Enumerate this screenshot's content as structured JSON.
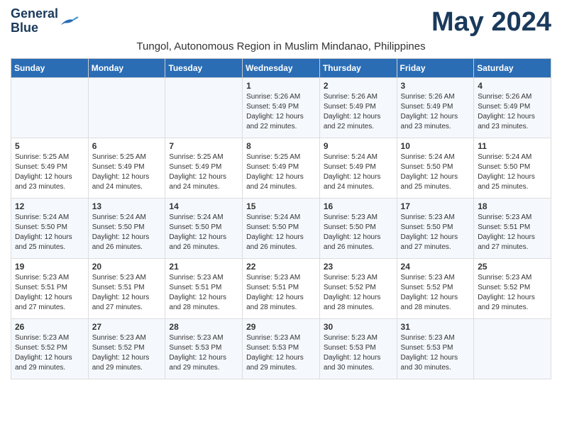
{
  "logo": {
    "line1": "General",
    "line2": "Blue"
  },
  "title": "May 2024",
  "location": "Tungol, Autonomous Region in Muslim Mindanao, Philippines",
  "days_of_week": [
    "Sunday",
    "Monday",
    "Tuesday",
    "Wednesday",
    "Thursday",
    "Friday",
    "Saturday"
  ],
  "weeks": [
    [
      {
        "day": "",
        "detail": ""
      },
      {
        "day": "",
        "detail": ""
      },
      {
        "day": "",
        "detail": ""
      },
      {
        "day": "1",
        "detail": "Sunrise: 5:26 AM\nSunset: 5:49 PM\nDaylight: 12 hours\nand 22 minutes."
      },
      {
        "day": "2",
        "detail": "Sunrise: 5:26 AM\nSunset: 5:49 PM\nDaylight: 12 hours\nand 22 minutes."
      },
      {
        "day": "3",
        "detail": "Sunrise: 5:26 AM\nSunset: 5:49 PM\nDaylight: 12 hours\nand 23 minutes."
      },
      {
        "day": "4",
        "detail": "Sunrise: 5:26 AM\nSunset: 5:49 PM\nDaylight: 12 hours\nand 23 minutes."
      }
    ],
    [
      {
        "day": "5",
        "detail": "Sunrise: 5:25 AM\nSunset: 5:49 PM\nDaylight: 12 hours\nand 23 minutes."
      },
      {
        "day": "6",
        "detail": "Sunrise: 5:25 AM\nSunset: 5:49 PM\nDaylight: 12 hours\nand 24 minutes."
      },
      {
        "day": "7",
        "detail": "Sunrise: 5:25 AM\nSunset: 5:49 PM\nDaylight: 12 hours\nand 24 minutes."
      },
      {
        "day": "8",
        "detail": "Sunrise: 5:25 AM\nSunset: 5:49 PM\nDaylight: 12 hours\nand 24 minutes."
      },
      {
        "day": "9",
        "detail": "Sunrise: 5:24 AM\nSunset: 5:49 PM\nDaylight: 12 hours\nand 24 minutes."
      },
      {
        "day": "10",
        "detail": "Sunrise: 5:24 AM\nSunset: 5:50 PM\nDaylight: 12 hours\nand 25 minutes."
      },
      {
        "day": "11",
        "detail": "Sunrise: 5:24 AM\nSunset: 5:50 PM\nDaylight: 12 hours\nand 25 minutes."
      }
    ],
    [
      {
        "day": "12",
        "detail": "Sunrise: 5:24 AM\nSunset: 5:50 PM\nDaylight: 12 hours\nand 25 minutes."
      },
      {
        "day": "13",
        "detail": "Sunrise: 5:24 AM\nSunset: 5:50 PM\nDaylight: 12 hours\nand 26 minutes."
      },
      {
        "day": "14",
        "detail": "Sunrise: 5:24 AM\nSunset: 5:50 PM\nDaylight: 12 hours\nand 26 minutes."
      },
      {
        "day": "15",
        "detail": "Sunrise: 5:24 AM\nSunset: 5:50 PM\nDaylight: 12 hours\nand 26 minutes."
      },
      {
        "day": "16",
        "detail": "Sunrise: 5:23 AM\nSunset: 5:50 PM\nDaylight: 12 hours\nand 26 minutes."
      },
      {
        "day": "17",
        "detail": "Sunrise: 5:23 AM\nSunset: 5:50 PM\nDaylight: 12 hours\nand 27 minutes."
      },
      {
        "day": "18",
        "detail": "Sunrise: 5:23 AM\nSunset: 5:51 PM\nDaylight: 12 hours\nand 27 minutes."
      }
    ],
    [
      {
        "day": "19",
        "detail": "Sunrise: 5:23 AM\nSunset: 5:51 PM\nDaylight: 12 hours\nand 27 minutes."
      },
      {
        "day": "20",
        "detail": "Sunrise: 5:23 AM\nSunset: 5:51 PM\nDaylight: 12 hours\nand 27 minutes."
      },
      {
        "day": "21",
        "detail": "Sunrise: 5:23 AM\nSunset: 5:51 PM\nDaylight: 12 hours\nand 28 minutes."
      },
      {
        "day": "22",
        "detail": "Sunrise: 5:23 AM\nSunset: 5:51 PM\nDaylight: 12 hours\nand 28 minutes."
      },
      {
        "day": "23",
        "detail": "Sunrise: 5:23 AM\nSunset: 5:52 PM\nDaylight: 12 hours\nand 28 minutes."
      },
      {
        "day": "24",
        "detail": "Sunrise: 5:23 AM\nSunset: 5:52 PM\nDaylight: 12 hours\nand 28 minutes."
      },
      {
        "day": "25",
        "detail": "Sunrise: 5:23 AM\nSunset: 5:52 PM\nDaylight: 12 hours\nand 29 minutes."
      }
    ],
    [
      {
        "day": "26",
        "detail": "Sunrise: 5:23 AM\nSunset: 5:52 PM\nDaylight: 12 hours\nand 29 minutes."
      },
      {
        "day": "27",
        "detail": "Sunrise: 5:23 AM\nSunset: 5:52 PM\nDaylight: 12 hours\nand 29 minutes."
      },
      {
        "day": "28",
        "detail": "Sunrise: 5:23 AM\nSunset: 5:53 PM\nDaylight: 12 hours\nand 29 minutes."
      },
      {
        "day": "29",
        "detail": "Sunrise: 5:23 AM\nSunset: 5:53 PM\nDaylight: 12 hours\nand 29 minutes."
      },
      {
        "day": "30",
        "detail": "Sunrise: 5:23 AM\nSunset: 5:53 PM\nDaylight: 12 hours\nand 30 minutes."
      },
      {
        "day": "31",
        "detail": "Sunrise: 5:23 AM\nSunset: 5:53 PM\nDaylight: 12 hours\nand 30 minutes."
      },
      {
        "day": "",
        "detail": ""
      }
    ]
  ]
}
